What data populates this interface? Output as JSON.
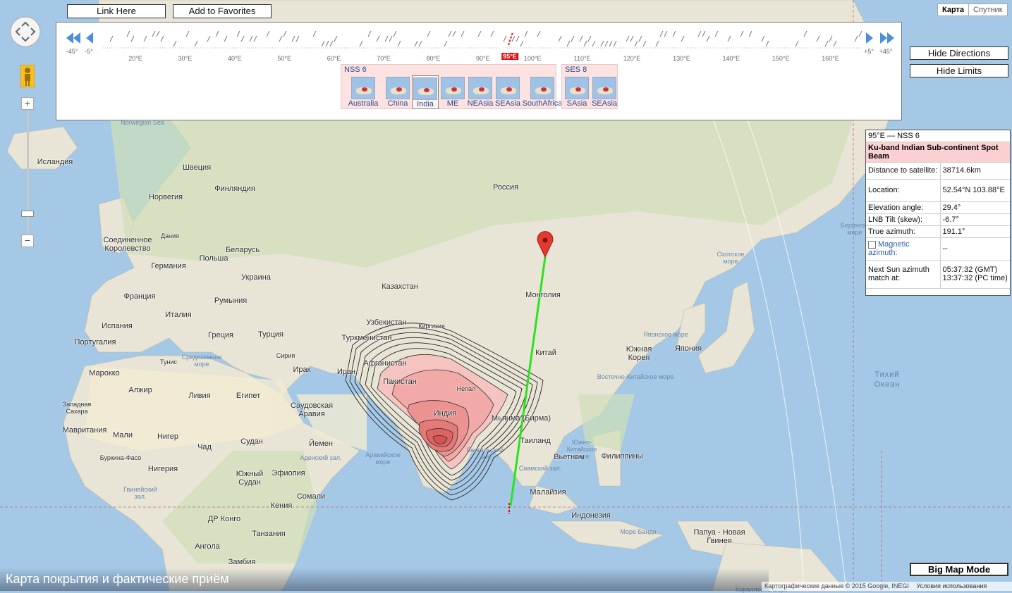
{
  "toolbar": {
    "link_here": "Link Here",
    "add_favorites": "Add to Favorites"
  },
  "map_type": {
    "map": "Карта",
    "satellite": "Спутник"
  },
  "side": {
    "hide_directions": "Hide Directions",
    "hide_limits": "Hide Limits",
    "big_map_mode": "Big Map Mode"
  },
  "longitude_bar": {
    "left_far": "-45°",
    "left_near": "-5°",
    "right_near": "+5°",
    "right_far": "+45°",
    "selected": "95°E",
    "ticks": [
      "20°E",
      "30°E",
      "40°E",
      "50°E",
      "60°E",
      "70°E",
      "80°E",
      "90°E",
      "100°E",
      "110°E",
      "120°E",
      "130°E",
      "140°E",
      "150°E",
      "160°E"
    ]
  },
  "beam_groups": [
    {
      "title": "NSS 6",
      "beams": [
        "Australia",
        "China",
        "India",
        "ME",
        "NEAsia",
        "SEAsia",
        "SouthAfrica"
      ],
      "selected": "India"
    },
    {
      "title": "SES 8",
      "beams": [
        "SAsia",
        "SEAsia"
      ]
    }
  ],
  "info": {
    "header": "95°E — NSS 6",
    "beam": "Ku-band Indian Sub-continent Spot Beam",
    "rows": [
      {
        "k": "Distance to satellite:",
        "v": "38714.6km"
      },
      {
        "k": "Location:",
        "v": "52.54°N 103.88°E"
      },
      {
        "k": "Elevation angle:",
        "v": "29.4°"
      },
      {
        "k": "LNB Tilt (skew):",
        "v": "-6.7°"
      },
      {
        "k": "True azimuth:",
        "v": "191.1°"
      },
      {
        "k": "Magnetic azimuth:",
        "v": "--"
      },
      {
        "k": "Next Sun azimuth match at:",
        "v": "05:37:32 (GMT) 13:37:32 (PC time)"
      }
    ]
  },
  "footer": {
    "attribution": "Картографические данные © 2015 Google, INEGI",
    "terms": "Условия использования"
  },
  "caption": "Карта покрытия и фактические приём",
  "map_labels": {
    "russia": "Россия",
    "kazakhstan": "Казахстан",
    "mongolia": "Монголия",
    "china": "Китай",
    "uzbekistan": "Узбекистан",
    "kyrgyzstan": "Киргизия",
    "turkmenistan": "Туркменистан",
    "afghanistan": "Афганистан",
    "pakistan": "Пакистан",
    "iran": "Иран",
    "iraq": "Ирак",
    "india": "Индия",
    "nepal": "Непал",
    "myanmar": "Мьянма (Бирма)",
    "thailand": "Таиланд",
    "vietnam": "Вьетнам",
    "philippines": "Филиппины",
    "malaysia": "Малайзия",
    "indonesia": "Индонезия",
    "papua": "Папуа - Новая Гвинея",
    "japan": "Япония",
    "south_korea": "Южная Корея",
    "iceland": "Исландия",
    "sweden": "Швеция",
    "finland": "Финляндия",
    "norway": "Норвегия",
    "denmark": "Дания",
    "uk": "Соединенное Королевство",
    "belarus": "Беларусь",
    "germany": "Германия",
    "poland": "Польша",
    "ukraine": "Украина",
    "france": "Франция",
    "romania": "Румыния",
    "italy": "Италия",
    "spain": "Испания",
    "portugal": "Португалия",
    "greece": "Греция",
    "turkey": "Турция",
    "tunisia": "Тунис",
    "morocco": "Марокко",
    "algeria": "Алжир",
    "libya": "Ливия",
    "egypt": "Египет",
    "w_sahara": "Западная Сахара",
    "mauritania": "Мавритания",
    "mali": "Мали",
    "niger": "Нигер",
    "chad": "Чад",
    "sudan": "Судан",
    "burkina": "Буркина-Фасо",
    "nigeria": "Нигерия",
    "ethiopia": "Эфиопия",
    "s_sudan": "Южный Судан",
    "somalia": "Сомали",
    "kenya": "Кения",
    "drc": "ДР Конго",
    "tanzania": "Танзания",
    "angola": "Ангола",
    "zambia": "Замбия",
    "saudi": "Саудовская Аравия",
    "yemen": "Йемен",
    "syria": "Сирия",
    "norwegian_sea": "Norwegian Sea",
    "med_sea": "Средиземное море",
    "arabian_sea": "Аравийское море",
    "bengal": "Бенгальский зал.",
    "aden": "Аденский зал.",
    "okhotsk": "Охотское море",
    "japan_sea": "Японское море",
    "east_china": "Восточно-Китайское море",
    "scs": "Южно-Китайское море",
    "siam": "Сиамский зал.",
    "guinea": "Гвинейский зал.",
    "bering": "Берингово море",
    "banda": "Море Банда",
    "coral": "Коралловое море",
    "pacific": "Тихий Океан"
  }
}
